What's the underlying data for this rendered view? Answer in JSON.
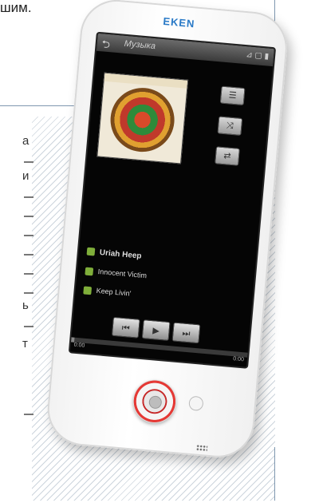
{
  "page": {
    "top_text": "шим.",
    "side_glyphs": [
      "а",
      "и",
      "ь",
      "т"
    ]
  },
  "device": {
    "brand": "EKEN",
    "screen": {
      "title": "Музыка",
      "back_symbol": "⮌",
      "status_icons": "⊿ ▢ ▮",
      "album_banner_text": "",
      "side_buttons": [
        {
          "name": "playlist-button",
          "glyph": "☰"
        },
        {
          "name": "shuffle-button",
          "glyph": "⤨"
        },
        {
          "name": "repeat-button",
          "glyph": "⇄"
        }
      ],
      "artist": "Uriah Heep",
      "album": "Innocent Victim",
      "track": "Keep Livin'",
      "controls": {
        "prev": "⏮",
        "play": "▶",
        "next": "⏭"
      },
      "progress": 0.02,
      "time_left": "0:00",
      "time_right": "0:00"
    }
  },
  "colors": {
    "brand": "#2a7ac7",
    "accent_red": "#e53935"
  }
}
